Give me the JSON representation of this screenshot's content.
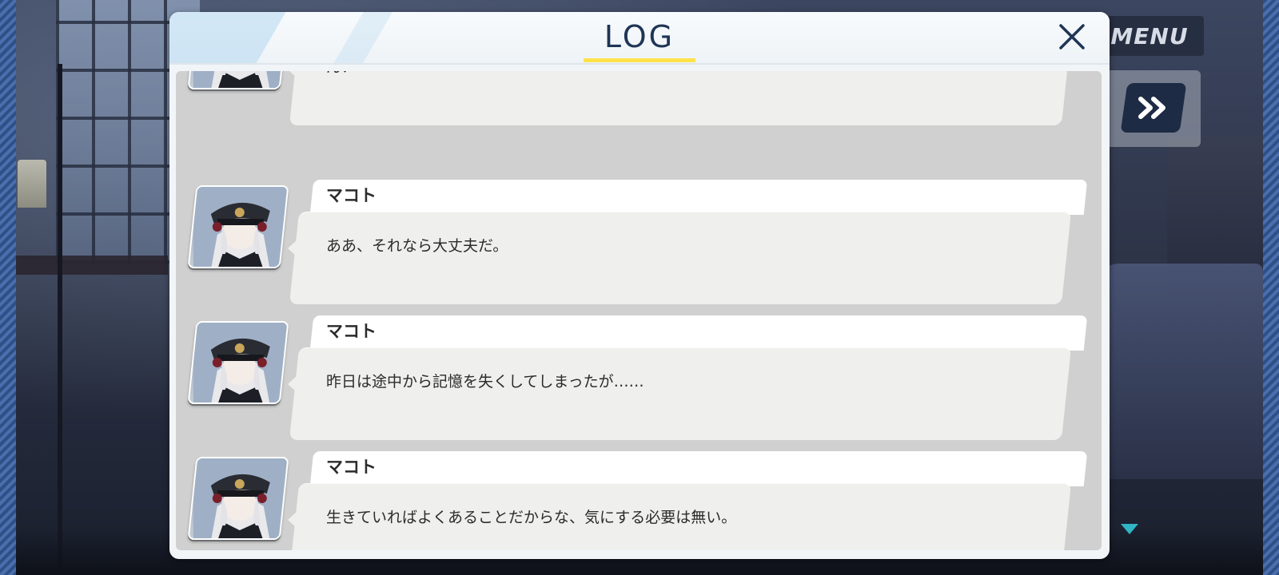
{
  "hud": {
    "menu_label": "MENU"
  },
  "log": {
    "title": "LOG",
    "entries": [
      {
        "speaker": "",
        "text": "ん？"
      },
      {
        "speaker": "マコト",
        "text": "ああ、それなら大丈夫だ。"
      },
      {
        "speaker": "マコト",
        "text": "昨日は途中から記憶を失くしてしまったが……"
      },
      {
        "speaker": "マコト",
        "text": "生きていればよくあることだからな、気にする必要は無い。"
      }
    ]
  },
  "colors": {
    "title_text": "#1f3556",
    "title_underline": "#ffe24a",
    "bubble": "#efefed",
    "log_background": "#cfd0cf",
    "scroll_indicator": "#2fb5c4"
  },
  "icons": {
    "close": "close-icon",
    "fast_forward": "fast-forward-icon",
    "scroll_down": "scroll-down-icon"
  }
}
